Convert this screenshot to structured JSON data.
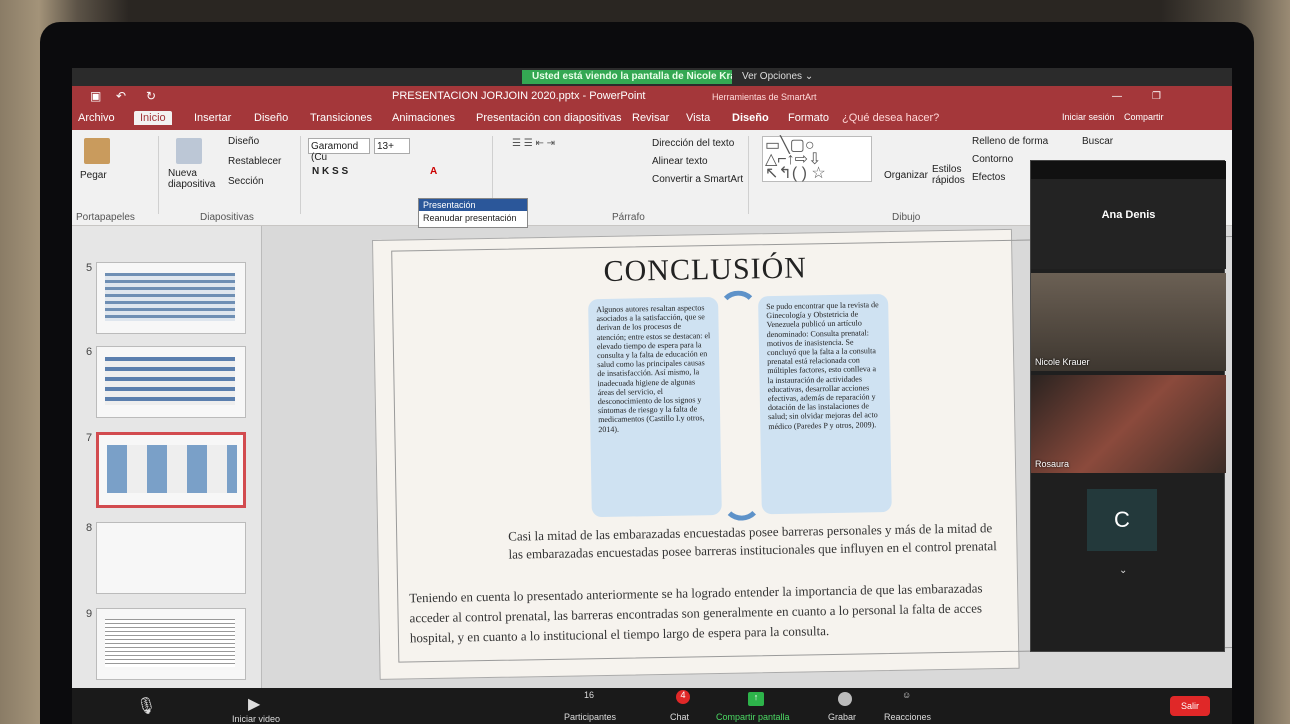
{
  "meeting": {
    "share_banner": "Usted está viendo la pantalla de Nicole Krauer",
    "view_options": "Ver Opciones ⌄"
  },
  "powerpoint": {
    "window_title": "PRESENTACION JORJOIN 2020.pptx - PowerPoint",
    "smartart_tools": "Herramientas de SmartArt",
    "title_actions": [
      "Iniciar sesión",
      "Compartir"
    ],
    "tabs": [
      "Archivo",
      "Inicio",
      "Insertar",
      "Diseño",
      "Transiciones",
      "Animaciones",
      "Presentación con diapositivas",
      "Revisar",
      "Vista",
      "Diseño",
      "Formato"
    ],
    "tell_me": "¿Qué desea hacer?",
    "ribbon": {
      "paste": "Pegar",
      "clipboard_group": "Portapapeles",
      "new_slide": "Nueva diapositiva",
      "layout": "Diseño",
      "reset": "Restablecer",
      "section": "Sección",
      "slides_group": "Diapositivas",
      "font_name": "Garamond (Cu",
      "font_size": "13+",
      "bold_italic": "N  K  S  S",
      "paragraph_group": "Párrafo",
      "text_direction": "Dirección del texto",
      "align_text": "Alinear texto",
      "convert_smartart": "Convertir a SmartArt",
      "arrange": "Organizar",
      "quick_styles": "Estilos rápidos",
      "drawing_group": "Dibujo",
      "shape_fill": "Relleno de forma",
      "shape_outline": "Contorno",
      "shape_effects": "Efectos",
      "find": "Buscar"
    },
    "popup": {
      "title": "Presentación",
      "resume": "Reanudar presentación"
    },
    "thumbnails": [
      {
        "num": "5"
      },
      {
        "num": "6"
      },
      {
        "num": "7",
        "selected": true
      },
      {
        "num": "8"
      },
      {
        "num": "9"
      }
    ],
    "slide": {
      "title": "CONCLUSIÓN",
      "left_col": "Algunos autores resaltan aspectos asociados a la satisfacción, que se derivan de los procesos de atención; entre estos se destacan: el elevado tiempo de espera para la consulta y la falta de educación en salud como las principales causas de insatisfacción. Así mismo, la inadecuada higiene de algunas áreas del servicio, el desconocimiento de los signos y síntomas de riesgo y la falta de medicamentos (Castillo I.y otros, 2014).",
      "right_col": "Se pudo encontrar que la revista de Ginecología y Obstetricia de Venezuela publicó un artículo denominado: Consulta prenatal: motivos de inasistencia. Se concluyó que la falta a la consulta prenatal está relacionada con múltiples factores, esto conlleva a la instauración de actividades educativas, desarrollar acciones efectivas, además de reparación y dotación de las instalaciones de salud; sin olvidar mejoras del acto médico (Paredes P y otros, 2009).",
      "line1": "Casi la mitad de las embarazadas encuestadas posee barreras personales y más de la mitad de",
      "line2": "las embarazadas encuestadas posee barreras institucionales que influyen en el control prenatal",
      "para1": "Teniendo en cuenta lo presentado anteriormente se ha logrado entender la importancia de que las embarazadas",
      "para2": "acceder al control prenatal, las barreras encontradas son generalmente en cuanto a lo personal la falta de acces",
      "para3": "hospital, y en cuanto a lo institucional el tiempo largo de espera para la consulta."
    }
  },
  "participants_panel": {
    "speaker": "Ana Denis",
    "videos": [
      "Nicole Krauer",
      "Rosaura"
    ],
    "avatar_letter": "C"
  },
  "zoom_bar": {
    "participants_label": "Participantes",
    "participants_count": "16",
    "chat_label": "Chat",
    "chat_badge": "4",
    "share_label": "Compartir pantalla",
    "record_label": "Grabar",
    "reactions_label": "Reacciones",
    "leave_label": "Salir",
    "video_label": "Iniciar video"
  },
  "colors": {
    "ppt_accent": "#a4373a",
    "share_green": "#34a853",
    "leave_red": "#e02828",
    "smartart_fill": "#cfe2f2"
  }
}
